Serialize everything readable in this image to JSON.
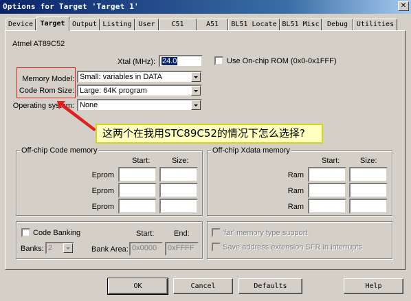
{
  "window": {
    "title": "Options for Target 'Target 1'",
    "close_glyph": "✕"
  },
  "tabs": [
    "Device",
    "Target",
    "Output",
    "Listing",
    "User",
    "C51",
    "A51",
    "BL51 Locate",
    "BL51 Misc",
    "Debug",
    "Utilities"
  ],
  "active_tab": "Target",
  "target": {
    "device_name": "Atmel AT89C52",
    "xtal_label": "Xtal (MHz):",
    "xtal_value": "24.0",
    "use_onchip_rom_label": "Use On-chip ROM (0x0-0x1FFF)",
    "memory_model_label": "Memory Model:",
    "memory_model_value": "Small: variables in DATA",
    "code_rom_size_label": "Code Rom Size:",
    "code_rom_size_value": "Large: 64K program",
    "os_label": "Operating system:",
    "os_value": "None"
  },
  "offchip_code": {
    "title": "Off-chip Code memory",
    "start_header": "Start:",
    "size_header": "Size:",
    "rows": [
      "Eprom",
      "Eprom",
      "Eprom"
    ]
  },
  "offchip_xdata": {
    "title": "Off-chip Xdata memory",
    "start_header": "Start:",
    "size_header": "Size:",
    "rows": [
      "Ram",
      "Ram",
      "Ram"
    ]
  },
  "banking": {
    "code_banking_label": "Code Banking",
    "start_header": "Start:",
    "end_header": "End:",
    "banks_label": "Banks:",
    "banks_value": "2",
    "bank_area_label": "Bank Area:",
    "bank_area_start": "0x0000",
    "bank_area_end": "0xFFFF"
  },
  "options": {
    "far_memory_label": "'far' memory type support",
    "save_sfr_label": "Save address extension SFR in interrupts"
  },
  "buttons": {
    "ok": "OK",
    "cancel": "Cancel",
    "defaults": "Defaults",
    "help": "Help"
  },
  "annotation": {
    "text": "这两个在我用STC89C52的情况下怎么选择?",
    "box_color": "#e02020",
    "callout_bg": "#ffffc0"
  }
}
